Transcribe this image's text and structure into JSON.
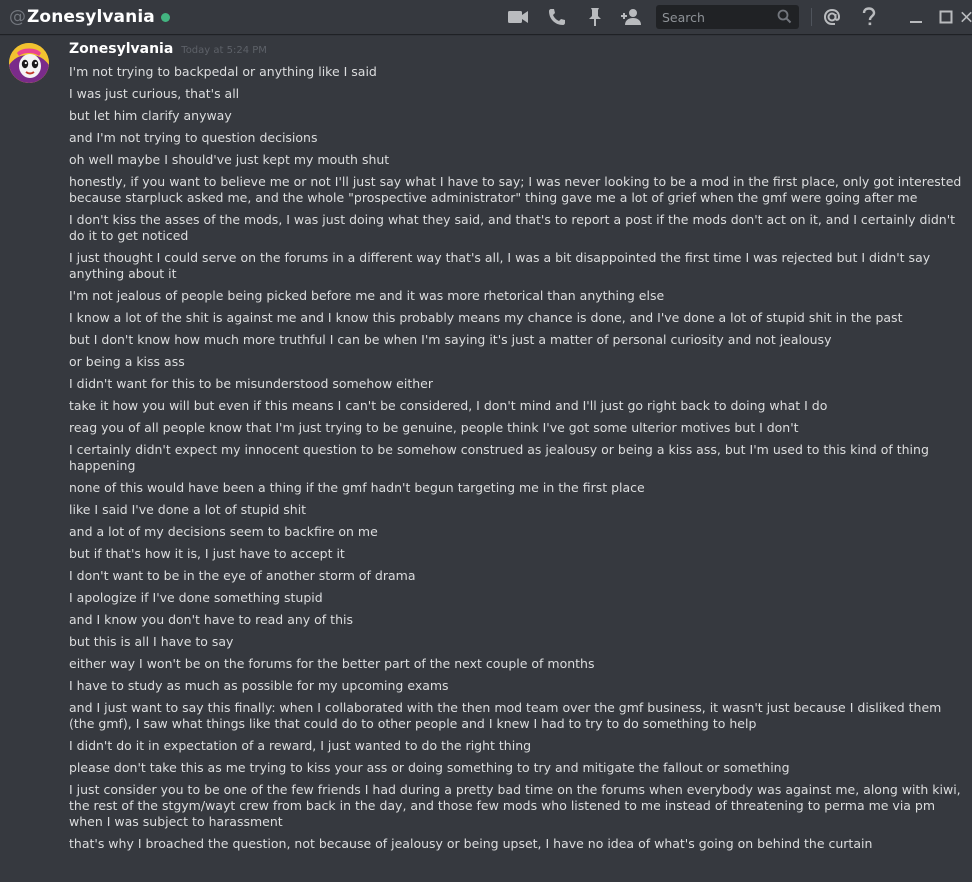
{
  "header": {
    "at_symbol": "@",
    "channel_name": "Zonesylvania",
    "status": "online",
    "status_color": "#43b581",
    "icons": [
      "video-call-icon",
      "voice-call-icon",
      "pin-icon",
      "add-friend-icon",
      "search-icon",
      "mention-icon",
      "help-icon",
      "minimize-icon",
      "maximize-icon",
      "close-icon"
    ]
  },
  "search": {
    "placeholder": "Search",
    "value": ""
  },
  "message_group": {
    "author": "Zonesylvania",
    "timestamp": "Today at 5:24 PM",
    "lines": [
      "I'm not trying to backpedal or anything like I said",
      "I was just curious, that's all",
      "but let him clarify anyway",
      "and I'm not trying to question decisions",
      "oh well maybe I should've just kept my mouth shut",
      "honestly, if you want to believe me or not I'll just say what I have to say; I was never looking to be a mod in the first place, only got interested because starpluck asked me, and the whole \"prospective administrator\" thing gave me a lot of grief when the gmf were going after me",
      "I don't kiss the asses of the mods, I was just doing what they said, and that's to report a post if the mods don't act on it, and I certainly didn't do it to get noticed",
      "I just thought I could serve on the forums in a different way that's all, I was a bit disappointed the first time I was rejected but I didn't say anything about it",
      "I'm not jealous of people being picked before me and it was more rhetorical than anything else",
      "I know a lot of the shit is against me and I know this probably means my chance is done, and I've done a lot of stupid shit in the past",
      "but I don't know how much more truthful I can be when I'm saying it's just a matter of personal curiosity and not jealousy",
      "or being a kiss ass",
      "I didn't want for this to be misunderstood somehow either",
      "take it how you will but even if this means I can't be considered, I don't mind and I'll just go right back to doing what I do",
      "reag you of all people know that I'm just trying to be genuine, people think I've got some ulterior motives but I don't",
      "I certainly didn't expect my innocent question to be somehow construed as jealousy or being a kiss ass, but I'm used to this kind of thing happening",
      "none of this would have been a thing if the gmf hadn't begun targeting me in the first place",
      "like I said I've done a lot of stupid shit",
      "and a lot of my decisions seem to backfire on me",
      "but if that's how it is, I just have to accept it",
      "I don't want to be in the eye of another storm of drama",
      "I apologize if I've done something stupid",
      "and I know you don't have to read any of this",
      "but this is all I have to say",
      "either way I won't be on the forums for the better part of the next couple of months",
      "I have to study as much as possible for my upcoming exams",
      "and I just want to say this finally: when I collaborated with the then mod team over the gmf business, it wasn't just because I disliked them (the gmf), I saw what things like that could do to other people and I knew I had to try to do something to help",
      "I didn't do it in expectation of a reward, I just wanted to do the right thing",
      "please don't take this as me trying to kiss your ass or doing something to try and mitigate the fallout or something",
      "I just consider you to be one of the few friends I had during a pretty bad time on the forums when everybody was against me, along with kiwi, the rest of the stgym/wayt crew from back in the day, and those few mods who listened to me instead of threatening to perma me via pm when I was subject to harassment",
      "that's why I broached the question, not because of jealousy or being upset, I have no idea of what's going on behind the curtain"
    ]
  }
}
